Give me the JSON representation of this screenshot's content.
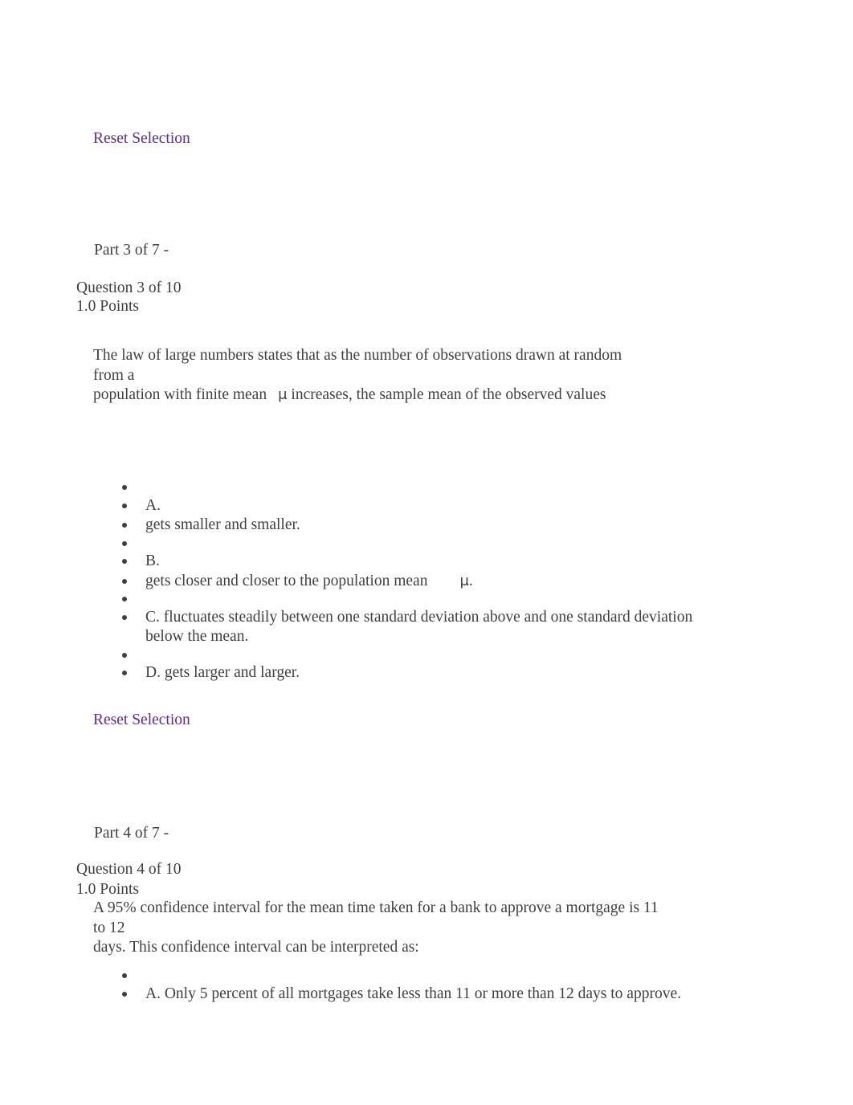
{
  "document": {
    "background_color": "#ffffff",
    "text_color": "#3f3f3f",
    "link_color": "#5b2e8c"
  },
  "reset_link_top": {
    "label": "Reset Selection"
  },
  "question_3": {
    "part_label": "Part 3 of 7 -",
    "question_number": "Question 3 of 10",
    "points": "1.0 Points",
    "prompt_line_1": "The law of large numbers states that as the number of observations drawn at random from a",
    "prompt_line_2a": "population with finite mean",
    "prompt_mu": "μ",
    "prompt_line_2b": "increases, the sample mean of the observed values",
    "options": [
      {
        "kind": "spacer",
        "text": ""
      },
      {
        "kind": "item",
        "text": "A."
      },
      {
        "kind": "item",
        "text": "gets smaller and smaller."
      },
      {
        "kind": "spacer",
        "text": ""
      },
      {
        "kind": "item",
        "text": "B."
      },
      {
        "kind": "item_mu",
        "text_before": "gets closer and closer to the population mean",
        "mu": "μ",
        "text_after": "."
      },
      {
        "kind": "spacer",
        "text": ""
      },
      {
        "kind": "item",
        "text": "C. fluctuates steadily between one standard deviation above and one standard deviation below the mean."
      },
      {
        "kind": "spacer",
        "text": ""
      },
      {
        "kind": "item",
        "text": "D. gets larger and larger."
      }
    ],
    "reset_label": "Reset Selection"
  },
  "question_4": {
    "part_label": "Part 4 of 7 -",
    "question_number": "Question 4 of 10",
    "points": "1.0 Points",
    "prompt_line_1": "A 95% confidence interval for the mean time taken for a bank to approve a mortgage is 11 to 12",
    "prompt_line_2": "days. This confidence interval can be interpreted as:",
    "options": [
      {
        "kind": "spacer",
        "text": ""
      },
      {
        "kind": "item",
        "text": "A. Only 5 percent of all mortgages take less than 11 or more than 12 days to approve."
      }
    ]
  }
}
